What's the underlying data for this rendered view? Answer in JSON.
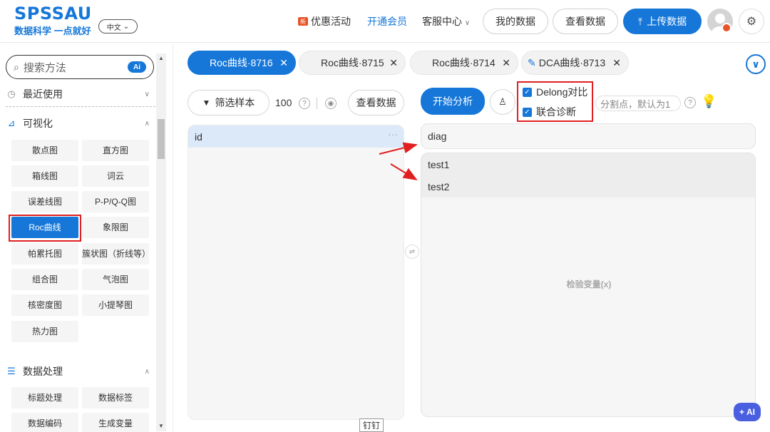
{
  "header": {
    "logo": "SPSSAU",
    "slogan": "数据科学 一点就好",
    "lang": "中文",
    "promo": "优惠活动",
    "promo_icon": "新",
    "vip": "开通会员",
    "service": "客服中心",
    "my_data": "我的数据",
    "view_data": "查看数据",
    "upload": "上传数据",
    "accent_color": "#1677d9"
  },
  "sidebar": {
    "search_placeholder": "搜索方法",
    "ai_badge": "Ai",
    "recent": "最近使用",
    "visual_section": "可视化",
    "charts": [
      "散点图",
      "直方图",
      "箱线图",
      "词云",
      "误差线图",
      "P-P/Q-Q图",
      "Roc曲线",
      "象限图",
      "帕累托图",
      "簇状图（折线等）",
      "组合图",
      "气泡图",
      "核密度图",
      "小提琴图",
      "热力图"
    ],
    "data_section": "数据处理",
    "data_items": [
      "标题处理",
      "数据标签",
      "数据编码",
      "生成变量"
    ]
  },
  "tabs": [
    {
      "label": "Roc曲线·8716",
      "active": true
    },
    {
      "label": "Roc曲线·8715",
      "active": false
    },
    {
      "label": "Roc曲线·8714",
      "active": false
    },
    {
      "label": "DCA曲线·8713",
      "active": false
    }
  ],
  "toolbar": {
    "filter": "筛选样本",
    "count": "100",
    "view_data": "查看数据",
    "start": "开始分析",
    "delong": "Delong对比",
    "joint": "联合诊断",
    "split_placeholder": "分割点，默认为1"
  },
  "panels": {
    "left_var": "id",
    "left_dots": "···",
    "diag": "diag",
    "tests": [
      "test1",
      "test2"
    ],
    "test_placeholder": "检验变量(x)"
  },
  "misc": {
    "ai_float": "+ AI",
    "pin": "钉钉"
  }
}
